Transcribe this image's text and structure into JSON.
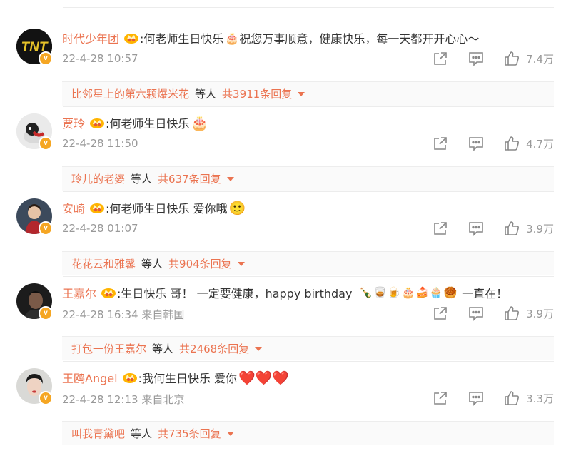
{
  "colors": {
    "accent": "#eb7350",
    "meta": "#999999",
    "badge": "#f5a623"
  },
  "icons": {
    "share": "share-icon",
    "comment": "comment-icon",
    "like": "thumbs-up-icon",
    "verified": "verified-v-badge",
    "crown": "fan-crown-badge"
  },
  "comments": [
    {
      "username": "时代少年团",
      "text": ":何老师生日快乐",
      "emoji": "🎂",
      "text2": "祝您万事顺意，健康快乐，每一天都开开心心～",
      "time": "22-4-28 10:57",
      "location": "",
      "likes": "7.4万",
      "reply_user": "比邻星上的第六颗爆米花",
      "reply_mid": "等人",
      "reply_count": "共3911条回复"
    },
    {
      "username": "贾玲",
      "text": ":何老师生日快乐",
      "emoji": "🎂",
      "text2": "",
      "time": "22-4-28 11:50",
      "location": "",
      "likes": "4.7万",
      "reply_user": "玲儿的老婆",
      "reply_mid": "等人",
      "reply_count": "共637条回复"
    },
    {
      "username": "安崎",
      "text": ":何老师生日快乐 爱你哦",
      "emoji": "🙂",
      "text2": "",
      "time": "22-4-28 01:07",
      "location": "",
      "likes": "3.9万",
      "reply_user": "花花云和雅馨",
      "reply_mid": "等人",
      "reply_count": "共904条回复"
    },
    {
      "username": "王嘉尔",
      "text": ":生日快乐 哥！ 一定要健康，happy birthday",
      "emoji": "🍾🥃🍺🎂🍰🧁🥮",
      "text2": "一直在！",
      "time": "22-4-28 16:34",
      "location": "来自韩国",
      "likes": "3.9万",
      "reply_user": "打包一份王嘉尔",
      "reply_mid": "等人",
      "reply_count": "共2468条回复"
    },
    {
      "username": "王鸥Angel",
      "text": ":我何生日快乐 爱你",
      "emoji": "❤️❤️❤️",
      "text2": "",
      "time": "22-4-28 12:13",
      "location": "来自北京",
      "likes": "3.3万",
      "reply_user": "叫我青黛吧",
      "reply_mid": "等人",
      "reply_count": "共735条回复"
    }
  ]
}
